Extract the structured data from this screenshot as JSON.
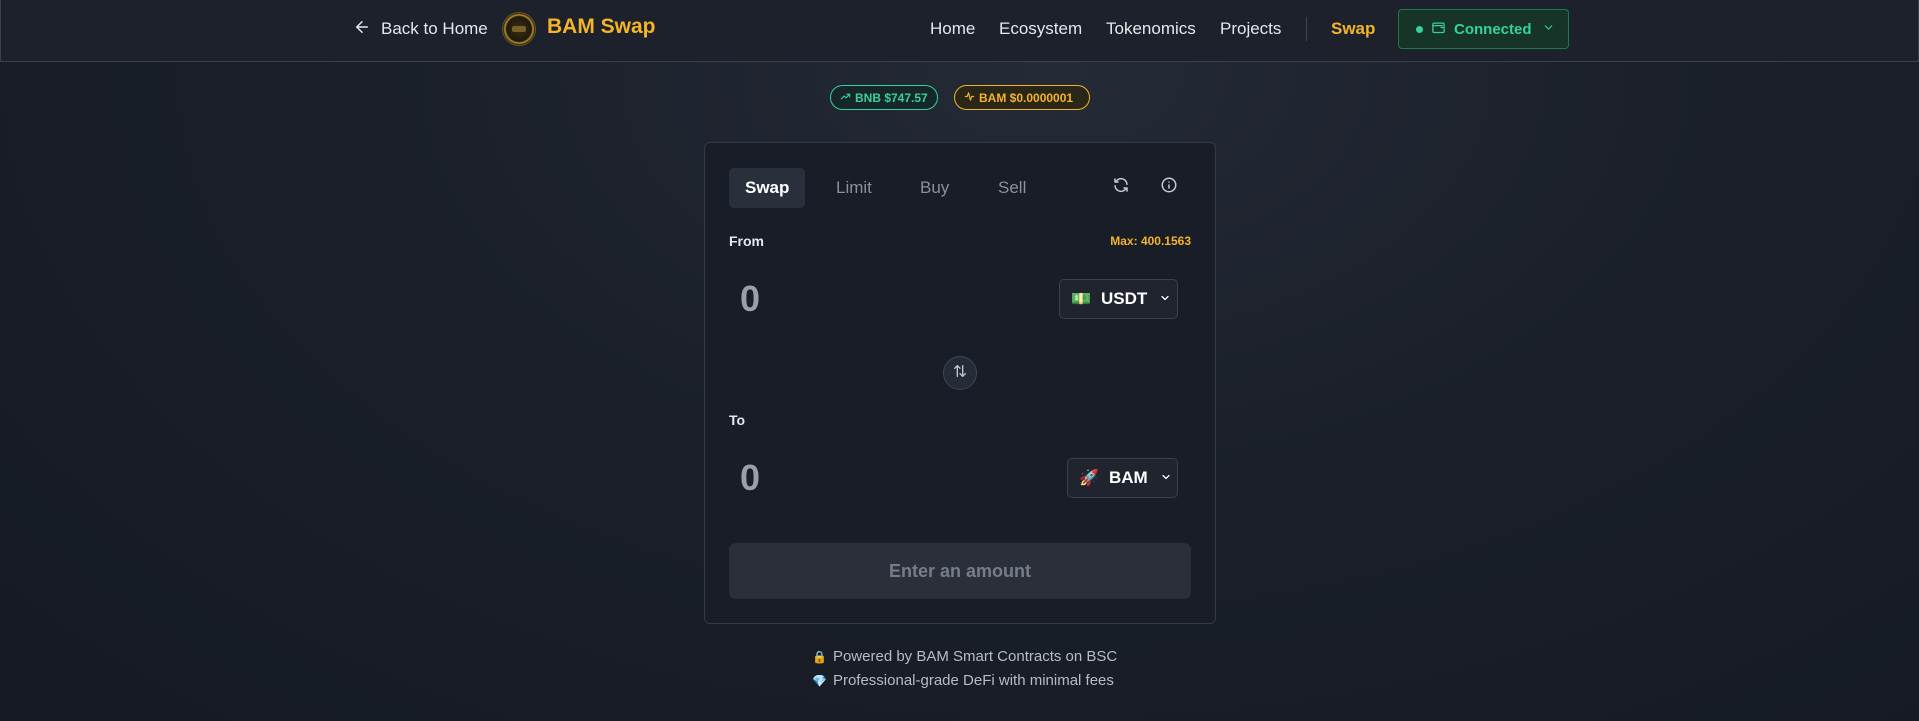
{
  "header": {
    "back_label": "Back to Home",
    "brand": "BAM Swap",
    "nav": [
      {
        "label": "Home"
      },
      {
        "label": "Ecosystem"
      },
      {
        "label": "Tokenomics"
      },
      {
        "label": "Projects"
      },
      {
        "label": "Swap"
      }
    ],
    "wallet_status": "Connected"
  },
  "prices": {
    "bnb": "BNB $747.57",
    "bam": "BAM $0.0000001"
  },
  "card": {
    "tabs": [
      {
        "label": "Swap"
      },
      {
        "label": "Limit"
      },
      {
        "label": "Buy"
      },
      {
        "label": "Sell"
      }
    ],
    "from": {
      "label": "From",
      "max": "Max: 400.1563",
      "placeholder": "0",
      "token": "USDT",
      "token_emoji": "💵"
    },
    "to": {
      "label": "To",
      "placeholder": "0",
      "token": "BAM",
      "token_emoji": "🚀"
    },
    "submit_label": "Enter an amount"
  },
  "footer": {
    "line1": "Powered by BAM Smart Contracts on BSC",
    "line1_emoji": "🔒",
    "line2": "Professional-grade DeFi with minimal fees",
    "line2_emoji": "💎"
  },
  "colors": {
    "accent": "#f4b429",
    "success": "#34d399",
    "background": "#1a1f29"
  }
}
